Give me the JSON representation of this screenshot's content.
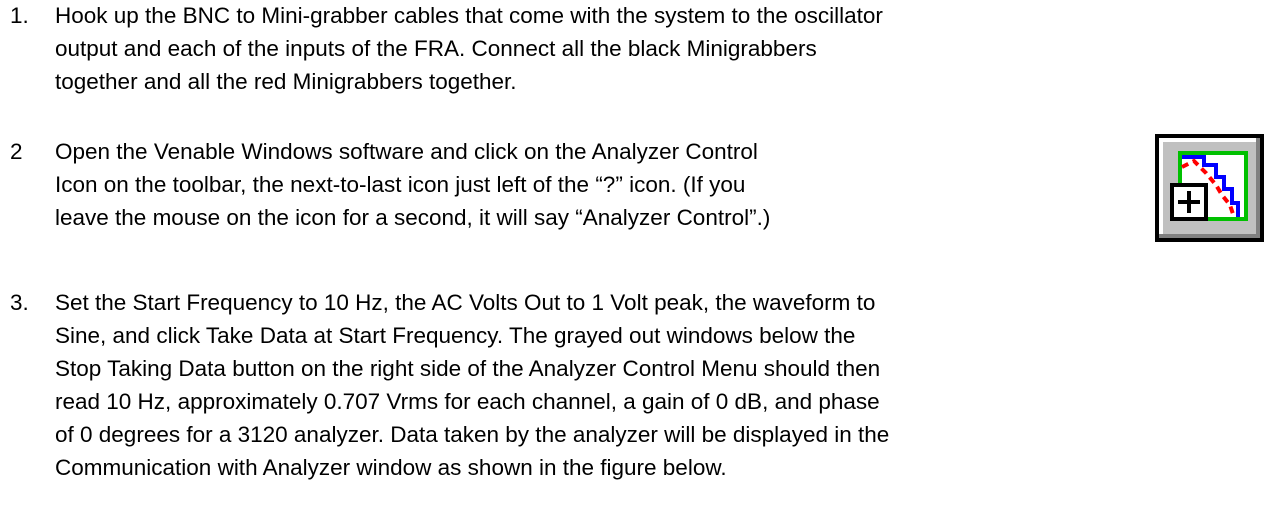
{
  "steps": [
    {
      "number": "1.",
      "lines": [
        "Hook up the BNC to Mini-grabber cables that come with the system to the oscillator",
        "output and each of the inputs of the FRA.  Connect all the black Minigrabbers",
        "together and all the red Minigrabbers together."
      ]
    },
    {
      "number": "2",
      "lines": [
        "Open the Venable Windows software and click on the Analyzer Control",
        "Icon on the toolbar, the next-to-last icon just left of the “?” icon.  (If you",
        "leave the mouse on the icon for a second, it will say “Analyzer Control”.)"
      ]
    },
    {
      "number": "3.",
      "lines": [
        "Set the Start Frequency to 10 Hz, the AC Volts Out to 1 Volt peak, the waveform to",
        "Sine, and click Take Data at Start Frequency.  The grayed out windows below the",
        "Stop Taking Data button on the right side of the Analyzer Control Menu should then",
        "read 10 Hz, approximately 0.707 Vrms for each channel, a gain of 0 dB, and phase",
        "of 0 degrees for a 3120 analyzer.  Data taken by the analyzer will be displayed in the",
        "Communication with Analyzer window as shown in the figure below."
      ]
    }
  ],
  "icon": {
    "name": "analyzer-control-icon",
    "colors": {
      "face": "#c0c0c0",
      "border": "#000000",
      "grid": "#00c000",
      "trace_red": "#ff0000",
      "trace_blue": "#0000ff"
    }
  }
}
